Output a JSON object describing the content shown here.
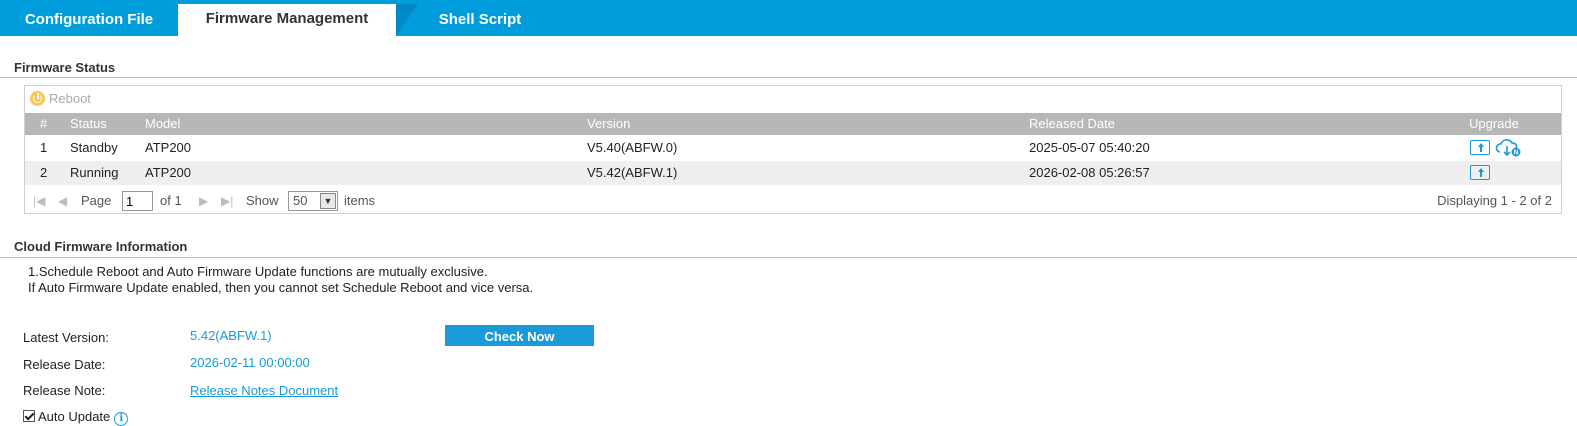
{
  "tabs": [
    {
      "label": "Configuration File"
    },
    {
      "label": "Firmware Management"
    },
    {
      "label": "Shell Script"
    }
  ],
  "firmware_status": {
    "title": "Firmware Status",
    "reboot_label": "Reboot",
    "columns": [
      "#",
      "Status",
      "Model",
      "Version",
      "Released Date",
      "Upgrade"
    ],
    "rows": [
      {
        "num": "1",
        "status": "Standby",
        "model": "ATP200",
        "version": "V5.40(ABFW.0)",
        "released": "2025-05-07 05:40:20",
        "upgrade_icons": [
          "upload-icon",
          "cloud-download-icon"
        ]
      },
      {
        "num": "2",
        "status": "Running",
        "model": "ATP200",
        "version": "V5.42(ABFW.1)",
        "released": "2026-02-08 05:26:57",
        "upgrade_icons": [
          "upload-icon"
        ]
      }
    ],
    "pager": {
      "page_label": "Page",
      "page_value": "1",
      "of_label": "of 1",
      "show_label": "Show",
      "show_value": "50",
      "items_label": "items",
      "displaying": "Displaying 1 - 2 of 2"
    }
  },
  "cloud_firmware": {
    "title": "Cloud Firmware Information",
    "note_line1": "1.Schedule Reboot and Auto Firmware Update functions are mutually exclusive.",
    "note_line2": "If Auto Firmware Update enabled, then you cannot set Schedule Reboot and vice versa.",
    "latest_version_label": "Latest Version:",
    "latest_version_value": "5.42(ABFW.1)",
    "release_date_label": "Release Date:",
    "release_date_value": "2026-02-11 00:00:00",
    "release_note_label": "Release Note:",
    "release_note_link": "Release Notes Document",
    "check_now_label": "Check Now",
    "auto_update_label": "Auto Update",
    "auto_update_checked": true
  },
  "colors": {
    "accent": "#009ddd",
    "link": "#1a9ad6",
    "header_gray": "#b7b7b7"
  }
}
